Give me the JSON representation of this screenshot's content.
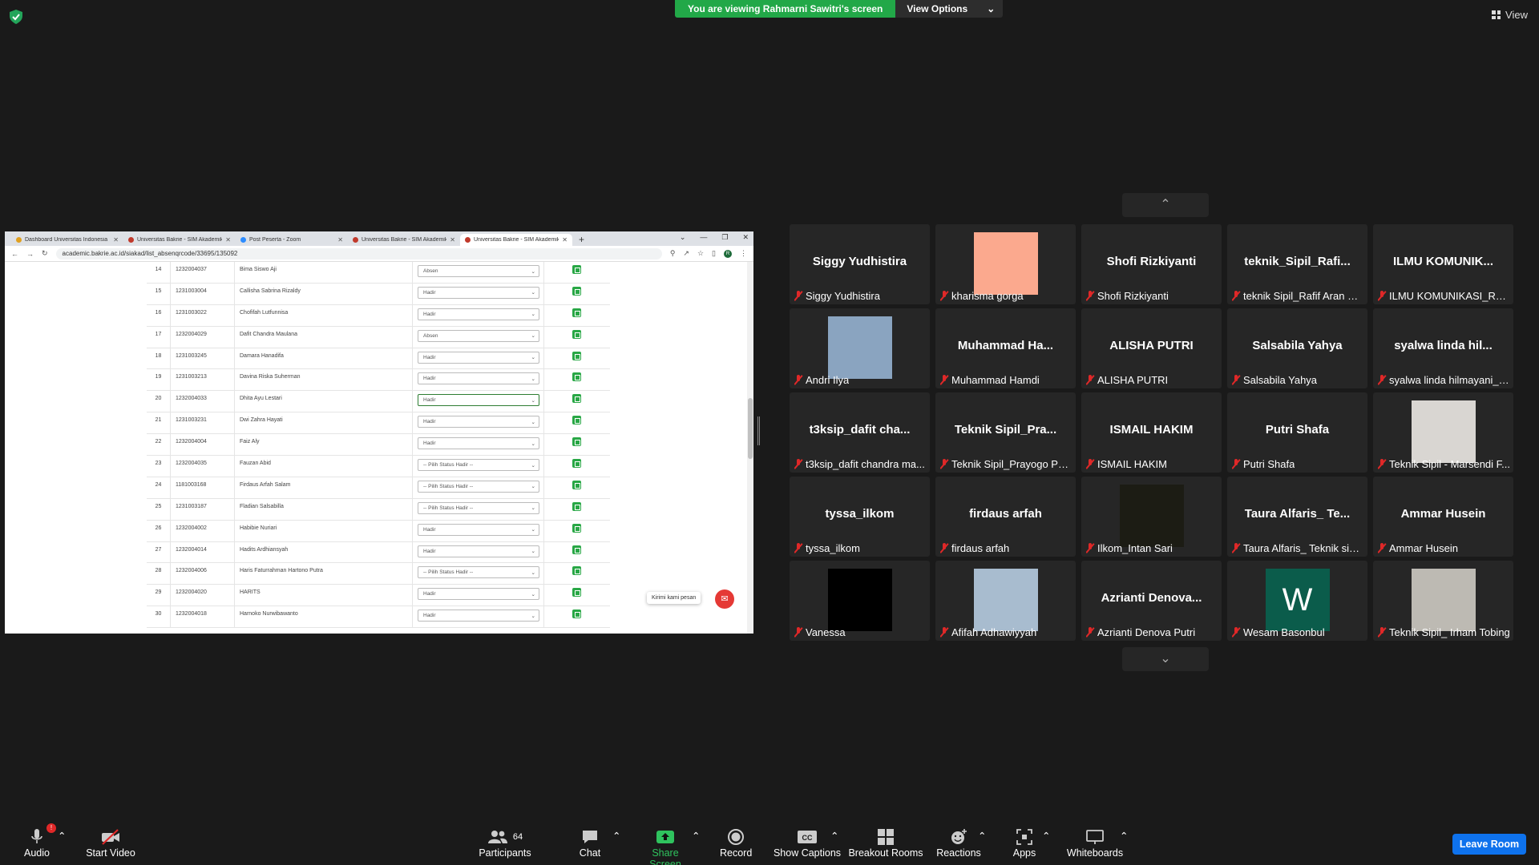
{
  "banner": {
    "viewing_text": "You are viewing Rahmarni Sawitri's screen",
    "view_options_label": "View Options",
    "view_label": "View"
  },
  "shared_screen": {
    "tabs": [
      {
        "label": "Dashboard Universitas Indonesia",
        "favicon": "dash"
      },
      {
        "label": "Universitas Bakrie - SIM Akademik",
        "favicon": "bakrie"
      },
      {
        "label": "Post Peserta - Zoom",
        "favicon": "zoom"
      },
      {
        "label": "Universitas Bakrie - SIM Akademik",
        "favicon": "bakrie"
      },
      {
        "label": "Universitas Bakrie - SIM Akademik",
        "favicon": "bakrie",
        "active": true
      }
    ],
    "url": "academic.bakrie.ac.id/siakad/list_absenqrcode/33695/135092",
    "rows": [
      {
        "no": "14",
        "nim": "1232004037",
        "name": "Bima Siswo Aji",
        "status": "Absen"
      },
      {
        "no": "15",
        "nim": "1231003004",
        "name": "Callisha Sabrina Rizaldy",
        "status": "Hadir"
      },
      {
        "no": "16",
        "nim": "1231003022",
        "name": "Chofifah Lutfunnisa",
        "status": "Hadir"
      },
      {
        "no": "17",
        "nim": "1232004029",
        "name": "Dafit Chandra Maulana",
        "status": "Absen"
      },
      {
        "no": "18",
        "nim": "1231003245",
        "name": "Damara Hanadifa",
        "status": "Hadir"
      },
      {
        "no": "19",
        "nim": "1231003213",
        "name": "Davina Riska Suherman",
        "status": "Hadir"
      },
      {
        "no": "20",
        "nim": "1232004033",
        "name": "Dhita Ayu Lestari",
        "status": "Hadir",
        "focus": true
      },
      {
        "no": "21",
        "nim": "1231003231",
        "name": "Dwi Zahra Hayati",
        "status": "Hadir"
      },
      {
        "no": "22",
        "nim": "1232004004",
        "name": "Faiz Aly",
        "status": "Hadir"
      },
      {
        "no": "23",
        "nim": "1232004035",
        "name": "Fauzan Abid",
        "status": "-- Pilih Status Hadir --"
      },
      {
        "no": "24",
        "nim": "1181003168",
        "name": "Firdaus Arfah Salam",
        "status": "-- Pilih Status Hadir --"
      },
      {
        "no": "25",
        "nim": "1231003187",
        "name": "Fladian Salsabilla",
        "status": "-- Pilih Status Hadir --"
      },
      {
        "no": "26",
        "nim": "1232004002",
        "name": "Habibie Nuriari",
        "status": "Hadir"
      },
      {
        "no": "27",
        "nim": "1232004014",
        "name": "Hadits Ardhiansyah",
        "status": "Hadir"
      },
      {
        "no": "28",
        "nim": "1232004006",
        "name": "Haris Faturrahman Hartono Putra",
        "status": "-- Pilih Status Hadir --"
      },
      {
        "no": "29",
        "nim": "1232004020",
        "name": "HARITS",
        "status": "Hadir"
      },
      {
        "no": "30",
        "nim": "1232004018",
        "name": "Harnoko Nurwibawanto",
        "status": "Hadir"
      }
    ],
    "chat_widget_text": "Kirimi kami pesan"
  },
  "participants": [
    {
      "big": "Siggy Yudhistira",
      "name": "Siggy Yudhistira",
      "pic": null
    },
    {
      "big": "",
      "name": "kharisma gorga",
      "pic": "#fba98e"
    },
    {
      "big": "Shofi Rizkiyanti",
      "name": "Shofi Rizkiyanti",
      "pic": null
    },
    {
      "big": "teknik_Sipil_Rafi...",
      "name": "teknik Sipil_Rafif Aran Ku...",
      "pic": null
    },
    {
      "big": "ILMU KOMUNIK...",
      "name": "ILMU KOMUNIKASI_RAH...",
      "pic": null
    },
    {
      "big": "",
      "name": "Andri Ilya",
      "pic": "#8aa4c0"
    },
    {
      "big": "Muhammad Ha...",
      "name": "Muhammad Hamdi",
      "pic": null
    },
    {
      "big": "ALISHA PUTRI",
      "name": "ALISHA PUTRI",
      "pic": null
    },
    {
      "big": "Salsabila Yahya",
      "name": "Salsabila Yahya",
      "pic": null
    },
    {
      "big": "syalwa linda hil...",
      "name": "syalwa linda hilmayani_t...",
      "pic": null
    },
    {
      "big": "t3ksip_dafit cha...",
      "name": "t3ksip_dafit chandra ma...",
      "pic": null
    },
    {
      "big": "Teknik Sipil_Pra...",
      "name": "Teknik Sipil_Prayogo Pan...",
      "pic": null
    },
    {
      "big": "ISMAIL HAKIM",
      "name": "ISMAIL HAKIM",
      "pic": null
    },
    {
      "big": "Putri Shafa",
      "name": "Putri Shafa",
      "pic": null
    },
    {
      "big": "",
      "name": "Teknik Sipil - Marsendi F...",
      "pic": "#d9d6d2"
    },
    {
      "big": "tyssa_ilkom",
      "name": "tyssa_ilkom",
      "pic": null
    },
    {
      "big": "firdaus arfah",
      "name": "firdaus arfah",
      "pic": null
    },
    {
      "big": "",
      "name": "Ilkom_Intan Sari",
      "pic": "#1c1c14"
    },
    {
      "big": "Taura Alfaris_ Te...",
      "name": "Taura Alfaris_ Teknik sipi...",
      "pic": null
    },
    {
      "big": "Ammar Husein",
      "name": "Ammar Husein",
      "pic": null
    },
    {
      "big": "",
      "name": "Vanessa",
      "pic": "#000000"
    },
    {
      "big": "",
      "name": "Afifah Adhawiyyah",
      "pic": "#a8bccf"
    },
    {
      "big": "Azrianti Denova...",
      "name": "Azrianti Denova Putri",
      "pic": null
    },
    {
      "big": "",
      "name": "Wesam Basonbul",
      "pic": "#0b5c4b",
      "letter": "W"
    },
    {
      "big": "",
      "name": "Teknik Sipil_ Irham Tobing",
      "pic": "#bdbab3"
    }
  ],
  "toolbar": {
    "audio": "Audio",
    "audio_badge": "!",
    "start_video": "Start Video",
    "participants": "Participants",
    "participants_count": "64",
    "chat": "Chat",
    "share_screen": "Share Screen",
    "record": "Record",
    "show_captions": "Show Captions",
    "breakout_rooms": "Breakout Rooms",
    "reactions": "Reactions",
    "apps": "Apps",
    "whiteboards": "Whiteboards",
    "leave_room": "Leave Room"
  }
}
